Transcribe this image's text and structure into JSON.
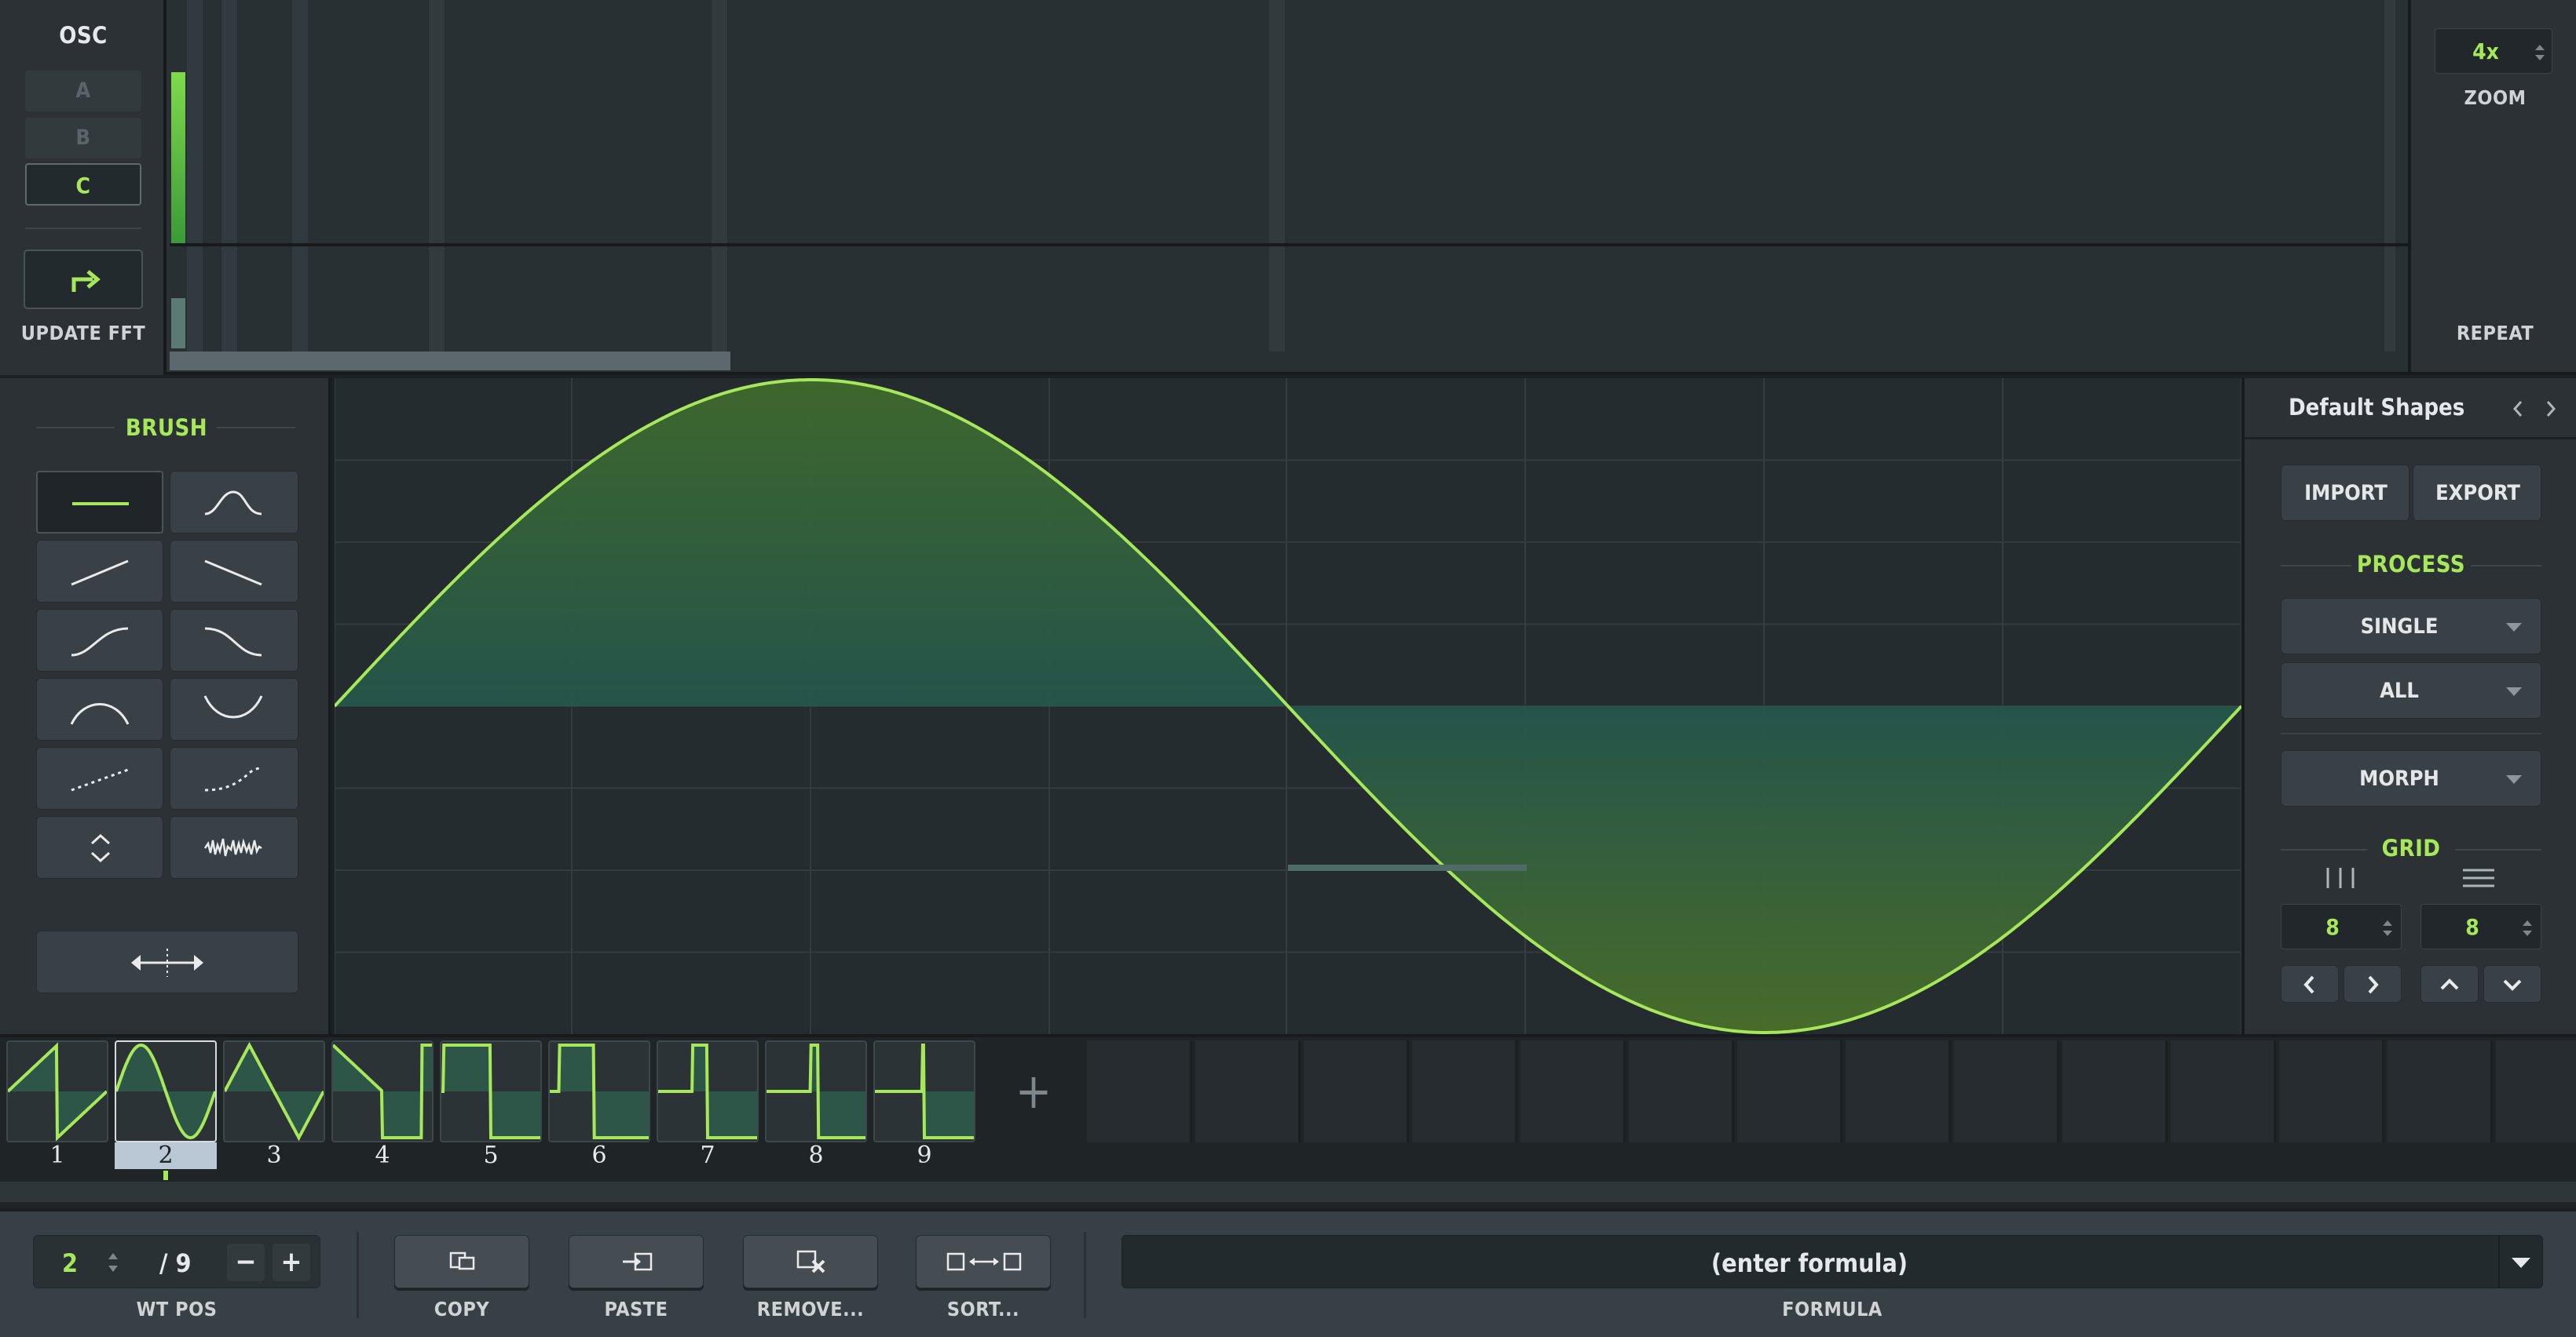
{
  "colors": {
    "accent": "#a6e85a",
    "wave_fill": "#24564c",
    "panel": "#2b3135",
    "dark": "#1f2427"
  },
  "osc": {
    "title": "OSC",
    "items": [
      "A",
      "B",
      "C"
    ],
    "selected": "C",
    "update_label": "UPDATE FFT",
    "update_icon": "redo-arrow-icon"
  },
  "zoom": {
    "value": "4x",
    "label": "ZOOM",
    "repeat_label": "REPEAT"
  },
  "brush": {
    "title": "BRUSH",
    "tools": [
      "flat-line-brush-icon",
      "s-curve-brush-icon",
      "rising-line-brush-icon",
      "falling-line-brush-icon",
      "ease-in-rise-brush-icon",
      "ease-out-fall-brush-icon",
      "arch-brush-icon",
      "valley-brush-icon",
      "dotted-rise-brush-icon",
      "dotted-curve-brush-icon",
      "expand-contract-brush-icon",
      "noise-brush-icon"
    ],
    "stretch_icon": "horizontal-stretch-icon"
  },
  "shapes": {
    "title": "Default Shapes",
    "import_label": "IMPORT",
    "export_label": "EXPORT",
    "process_title": "PROCESS",
    "process_mode": "SINGLE",
    "process_target": "ALL",
    "morph": "MORPH",
    "grid_title": "GRID",
    "grid_x": "8",
    "grid_y": "8"
  },
  "frames": {
    "labels": [
      "1",
      "2",
      "3",
      "4",
      "5",
      "6",
      "7",
      "8",
      "9"
    ],
    "selected": 2,
    "add_label": "+",
    "waves": [
      "saw",
      "sine",
      "triangle",
      "ramp",
      "pulse-wide",
      "pulse",
      "pulse-narrow",
      "pulse-narrower",
      "spike"
    ]
  },
  "footer": {
    "wt_pos_value": "2",
    "wt_pos_total": "/ 9",
    "wt_pos_label": "WT POS",
    "minus": "−",
    "plus": "+",
    "copy": "COPY",
    "paste": "PASTE",
    "remove": "REMOVE...",
    "sort": "SORT...",
    "formula_placeholder": "(enter formula)",
    "formula_label": "FORMULA"
  }
}
